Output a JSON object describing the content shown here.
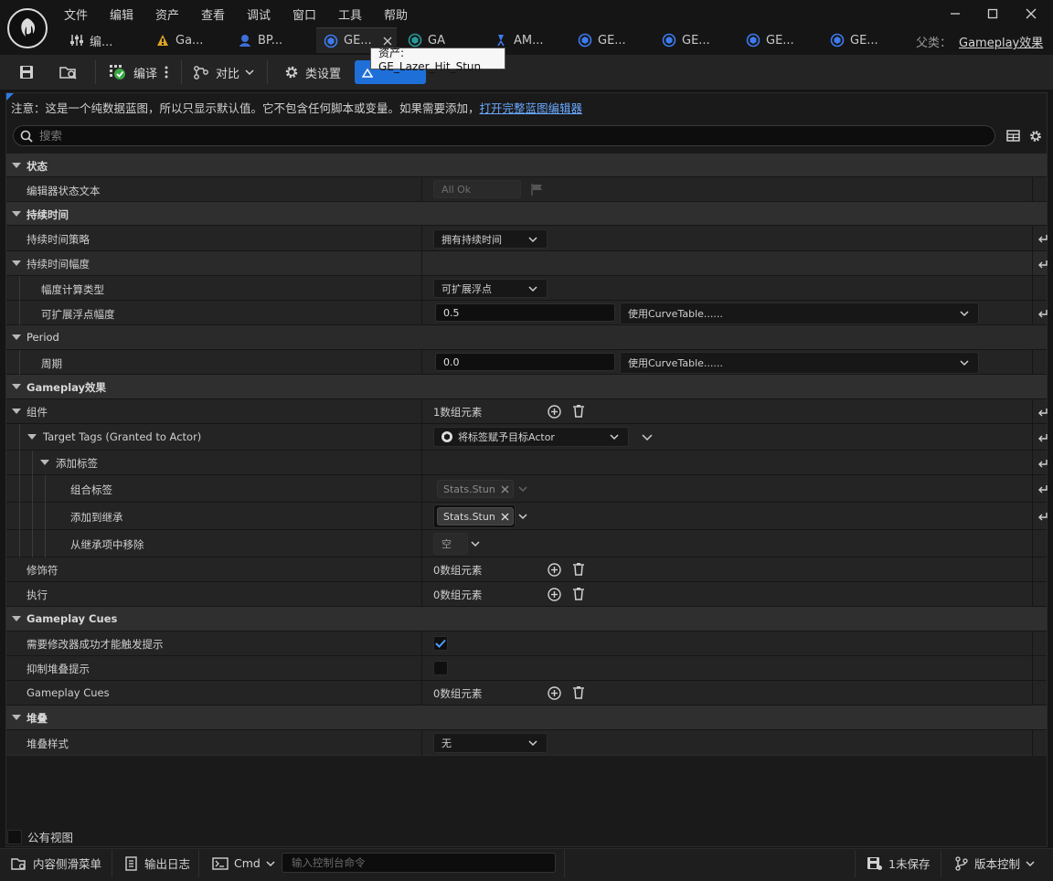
{
  "menu": {
    "items": [
      "文件",
      "编辑",
      "资产",
      "查看",
      "调试",
      "窗口",
      "工具",
      "帮助"
    ]
  },
  "tabs": [
    {
      "label": "编...",
      "icon": "blueprint-graph-icon"
    },
    {
      "label": "Ga...",
      "icon": "gameplay-warning-icon"
    },
    {
      "label": "BP...",
      "icon": "character-icon"
    },
    {
      "label": "GE...",
      "icon": "gameplay-effect-icon",
      "active": true
    },
    {
      "label": "GA",
      "icon": "gameplay-effect-icon"
    },
    {
      "label": "AM...",
      "icon": "animation-montage-icon"
    },
    {
      "label": "GE...",
      "icon": "gameplay-effect-icon"
    },
    {
      "label": "GE...",
      "icon": "gameplay-effect-icon"
    },
    {
      "label": "GE...",
      "icon": "gameplay-effect-icon"
    },
    {
      "label": "GE...",
      "icon": "gameplay-effect-icon"
    }
  ],
  "parent": {
    "label": "父类：",
    "value": "Gameplay效果"
  },
  "tooltip": "资产: GE_Lazer_Hit_Stun",
  "toolbar": {
    "compile_label": "编译",
    "diff_label": "对比",
    "class_settings_label": "类设置"
  },
  "notice": {
    "text": "注意：这是一个纯数据蓝图，所以只显示默认值。它不包含任何脚本或变量。如果需要添加，",
    "link": "打开完整蓝图编辑器"
  },
  "search": {
    "placeholder": "搜索"
  },
  "details": {
    "status_cat": "状态",
    "editor_status_text_label": "编辑器状态文本",
    "editor_status_text_value": "All Ok",
    "duration_cat": "持续时间",
    "duration_policy_label": "持续时间策略",
    "duration_policy_value": "拥有持续时间",
    "duration_magnitude_label": "持续时间幅度",
    "magnitude_calc_type_label": "幅度计算类型",
    "magnitude_calc_type_value": "可扩展浮点",
    "scalable_float_label": "可扩展浮点幅度",
    "scalable_float_value": "0.5",
    "curve_table_value": "使用CurveTable......",
    "period_cat": "Period",
    "period_label": "周期",
    "period_value": "0.0",
    "period_curve_value": "使用CurveTable......",
    "gameplay_effect_cat": "Gameplay效果",
    "components_label": "组件",
    "components_count": "1数组元素",
    "target_tags_label": "Target Tags (Granted to Actor)",
    "target_tags_value": "将标签赋予目标Actor",
    "add_tags_label": "添加标签",
    "combined_tags_label": "组合标签",
    "combined_tags_value": "Stats.Stun",
    "added_to_inheritance_label": "添加到继承",
    "added_to_inheritance_value": "Stats.Stun",
    "removed_from_inheritance_label": "从继承项中移除",
    "removed_from_inheritance_value": "空",
    "modifiers_label": "修饰符",
    "modifiers_count": "0数组元素",
    "executions_label": "执行",
    "executions_count": "0数组元素",
    "gameplay_cues_cat": "Gameplay Cues",
    "require_modifier_success_label": "需要修改器成功才能触发提示",
    "require_modifier_success_checked": true,
    "suppress_stacking_cues_label": "抑制堆叠提示",
    "suppress_stacking_cues_checked": false,
    "gameplay_cues_label": "Gameplay Cues",
    "gameplay_cues_count": "0数组元素",
    "stacking_cat": "堆叠",
    "stacking_type_label": "堆叠样式",
    "stacking_type_value": "无"
  },
  "public_view_label": "公有视图",
  "statusbar": {
    "content_drawer": "内容侧滑菜单",
    "output_log": "输出日志",
    "cmd_label": "Cmd",
    "cmd_placeholder": "输入控制台命令",
    "unsaved": "1未保存",
    "source_control": "版本控制"
  },
  "colors": {
    "accent": "#1f6fd9",
    "link": "#6aa8ff",
    "panel": "#242424",
    "category": "#2f2f2f"
  }
}
